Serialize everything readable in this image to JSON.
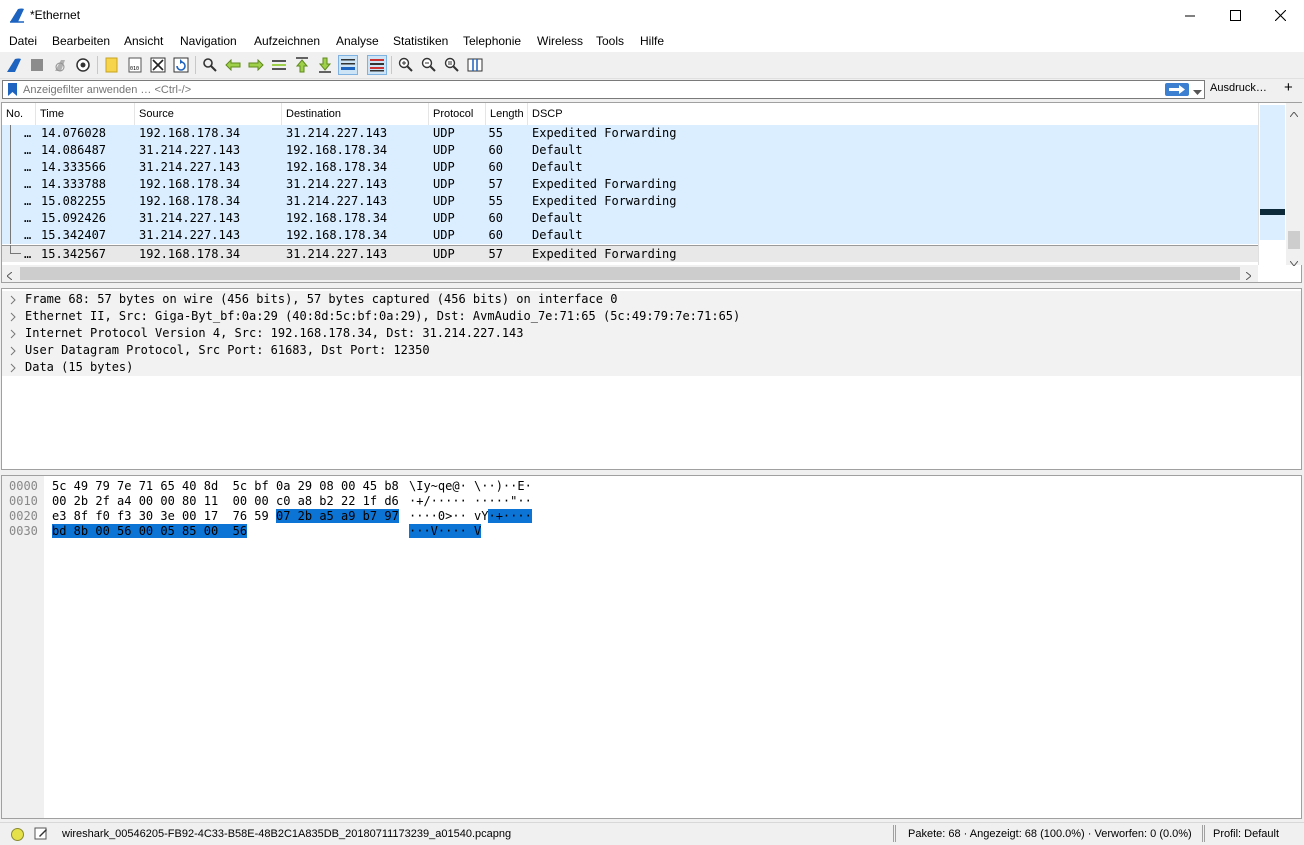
{
  "window": {
    "title": "*Ethernet"
  },
  "menu": [
    "Datei",
    "Bearbeiten",
    "Ansicht",
    "Navigation",
    "Aufzeichnen",
    "Analyse",
    "Statistiken",
    "Telephonie",
    "Wireless",
    "Tools",
    "Hilfe"
  ],
  "toolbar": {
    "icons": [
      "start-capture-icon",
      "stop-capture-icon",
      "restart-capture-icon",
      "capture-options-icon",
      "open-file-icon",
      "save-file-icon",
      "close-file-icon",
      "reload-file-icon",
      "find-packet-icon",
      "go-back-icon",
      "go-forward-icon",
      "go-to-packet-icon",
      "first-packet-icon",
      "last-packet-icon",
      "autoscroll-icon",
      "colorize-icon",
      "zoom-in-icon",
      "zoom-out-icon",
      "zoom-normal-icon",
      "resize-columns-icon"
    ]
  },
  "filter": {
    "placeholder": "Anzeigefilter anwenden … <Ctrl-/>",
    "expression_label": "Ausdruck…",
    "add_label": "+"
  },
  "packet_list": {
    "columns": [
      "No.",
      "Time",
      "Source",
      "Destination",
      "Protocol",
      "Length",
      "DSCP"
    ],
    "rows": [
      {
        "no": "…",
        "time": "14.076028",
        "source": "192.168.178.34",
        "destination": "31.214.227.143",
        "protocol": "UDP",
        "length": "55",
        "dscp": "Expedited Forwarding"
      },
      {
        "no": "…",
        "time": "14.086487",
        "source": "31.214.227.143",
        "destination": "192.168.178.34",
        "protocol": "UDP",
        "length": "60",
        "dscp": "Default"
      },
      {
        "no": "…",
        "time": "14.333566",
        "source": "31.214.227.143",
        "destination": "192.168.178.34",
        "protocol": "UDP",
        "length": "60",
        "dscp": "Default"
      },
      {
        "no": "…",
        "time": "14.333788",
        "source": "192.168.178.34",
        "destination": "31.214.227.143",
        "protocol": "UDP",
        "length": "57",
        "dscp": "Expedited Forwarding"
      },
      {
        "no": "…",
        "time": "15.082255",
        "source": "192.168.178.34",
        "destination": "31.214.227.143",
        "protocol": "UDP",
        "length": "55",
        "dscp": "Expedited Forwarding"
      },
      {
        "no": "…",
        "time": "15.092426",
        "source": "31.214.227.143",
        "destination": "192.168.178.34",
        "protocol": "UDP",
        "length": "60",
        "dscp": "Default"
      },
      {
        "no": "…",
        "time": "15.342407",
        "source": "31.214.227.143",
        "destination": "192.168.178.34",
        "protocol": "UDP",
        "length": "60",
        "dscp": "Default"
      },
      {
        "no": "…",
        "time": "15.342567",
        "source": "192.168.178.34",
        "destination": "31.214.227.143",
        "protocol": "UDP",
        "length": "57",
        "dscp": "Expedited Forwarding",
        "selected": true
      }
    ]
  },
  "details": [
    "Frame 68: 57 bytes on wire (456 bits), 57 bytes captured (456 bits) on interface 0",
    "Ethernet II, Src: Giga-Byt_bf:0a:29 (40:8d:5c:bf:0a:29), Dst: AvmAudio_7e:71:65 (5c:49:79:7e:71:65)",
    "Internet Protocol Version 4, Src: 192.168.178.34, Dst: 31.214.227.143",
    "User Datagram Protocol, Src Port: 61683, Dst Port: 12350",
    "Data (15 bytes)"
  ],
  "bytes": [
    {
      "offset": "0000",
      "hex": "5c 49 79 7e 71 65 40 8d  5c bf 0a 29 08 00 45 b8",
      "hex_hl": "",
      "ascii": "\\Iy~qe@· \\··)··E·",
      "ascii_hl": ""
    },
    {
      "offset": "0010",
      "hex": "00 2b 2f a4 00 00 80 11  00 00 c0 a8 b2 22 1f d6",
      "hex_hl": "",
      "ascii": "·+/····· ·····\"··",
      "ascii_hl": ""
    },
    {
      "offset": "0020",
      "hex": "e3 8f f0 f3 30 3e 00 17  76 59 ",
      "hex_hl": "07 2b a5 a9 b7 97",
      "ascii": "····0>·· vY",
      "ascii_hl": "·+····"
    },
    {
      "offset": "0030",
      "hex": "",
      "hex_hl": "bd 8b 00 56 00 05 85 00  56",
      "ascii": "",
      "ascii_hl": "···V···· V"
    }
  ],
  "status": {
    "file": "wireshark_00546205-FB92-4C33-B58E-48B2C1A835DB_20180711173239_a01540.pcapng",
    "packets": "Pakete: 68 · Angezeigt: 68 (100.0%) · Verworfen: 0 (0.0%)",
    "profile": "Profil: Default"
  },
  "colors": {
    "row_bg": "#daeeff",
    "highlight": "#0c74d5",
    "selected_row": "#e8e8e8"
  }
}
